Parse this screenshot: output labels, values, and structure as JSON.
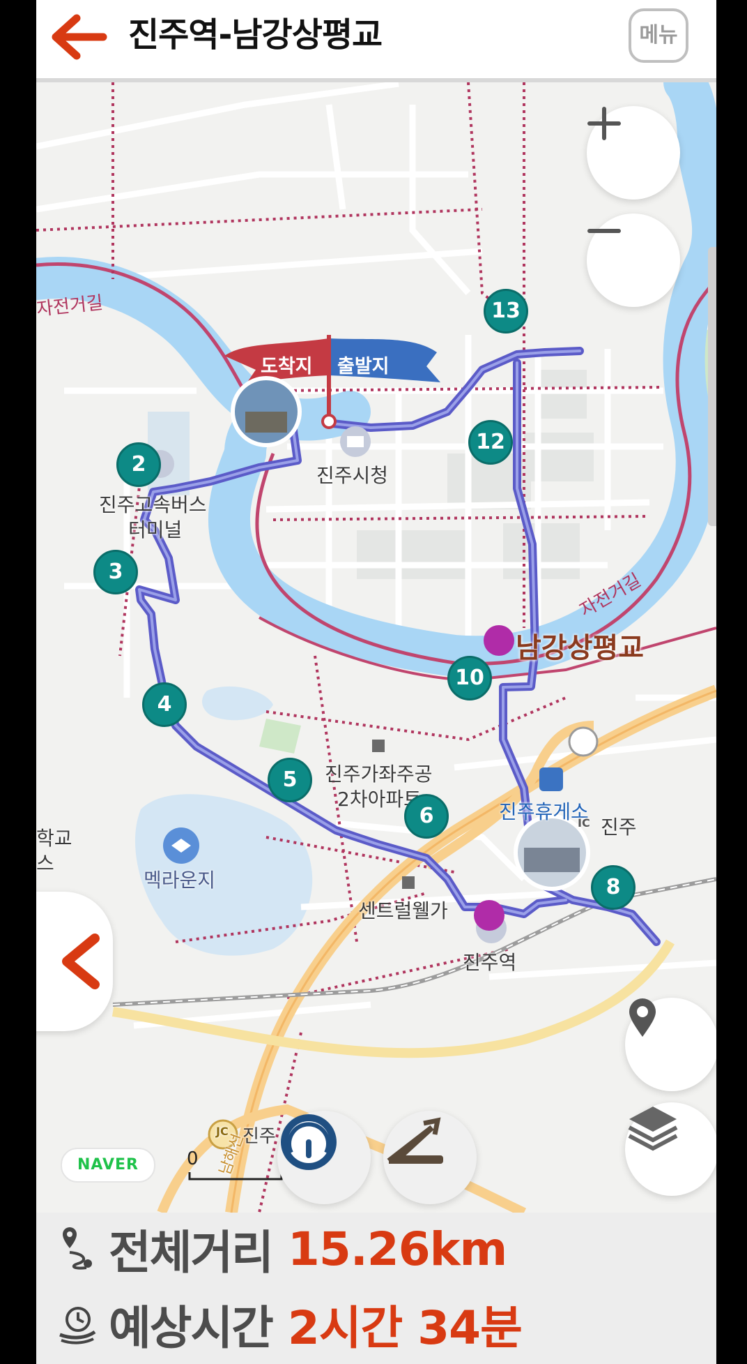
{
  "header": {
    "title": "진주역-남강상평교",
    "menu_label": "메뉴"
  },
  "colors": {
    "accent": "#d83a12",
    "marker": "#0d8a86",
    "route": "#4a4ab8",
    "river": "#a9d6f5",
    "bike_road": "#b0355e"
  },
  "map": {
    "labels": {
      "city_hall": "진주시청",
      "bus_terminal_1": "진주고속버스",
      "bus_terminal_2": "터미널",
      "apartment_1": "진주가좌주공",
      "apartment_2": "2차아파트",
      "rest_area": "진주휴게소",
      "ic": "진주",
      "lake": "멕라운지",
      "mall": "센트럴웰가",
      "station": "진주역",
      "school_1": "학교",
      "school_2": "스",
      "jc": "진주",
      "bike_road_left": "자전거길",
      "bike_road_right": "자전거길",
      "bridge": "남강상평교",
      "highway": "남해선"
    },
    "flags": {
      "arrive": "도착지",
      "depart": "출발지"
    },
    "badges": {
      "ic": "IC",
      "jc": "JC"
    },
    "markers": [
      "2",
      "3",
      "4",
      "5",
      "6",
      "8",
      "10",
      "12",
      "13"
    ],
    "brand": "NAVER",
    "scale_zero": "0",
    "icons": [
      "back-arrow-icon",
      "plus-icon",
      "minus-icon",
      "location-pin-icon",
      "layers-icon",
      "speedometer-icon",
      "slope-icon",
      "chevron-left-icon",
      "bicycle-icon",
      "route-icon",
      "clock-icon"
    ]
  },
  "info": {
    "distance_label": "전체거리",
    "distance_value": "15.26km",
    "time_label": "예상시간",
    "time_value": "2시간 34분"
  }
}
